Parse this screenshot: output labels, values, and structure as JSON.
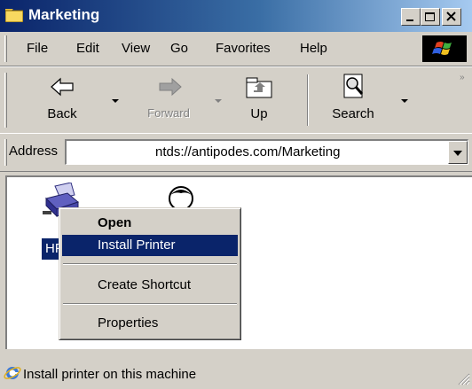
{
  "window": {
    "title": "Marketing"
  },
  "menu": [
    "File",
    "Edit",
    "View",
    "Go",
    "Favorites",
    "Help"
  ],
  "toolbar": {
    "back": "Back",
    "forward": "Forward",
    "up": "Up",
    "search": "Search"
  },
  "address": {
    "label": "Address",
    "value": "ntds://antipodes.com/Marketing"
  },
  "content": {
    "printer_label": "HP"
  },
  "context_menu": {
    "open": "Open",
    "install": "Install Printer",
    "shortcut": "Create Shortcut",
    "properties": "Properties"
  },
  "status": {
    "text": "Install printer on this machine"
  },
  "colors": {
    "title_gradient_start": "#0a246a",
    "title_gradient_end": "#a6caf0",
    "selection": "#0a246a",
    "face": "#d4d0c8"
  }
}
